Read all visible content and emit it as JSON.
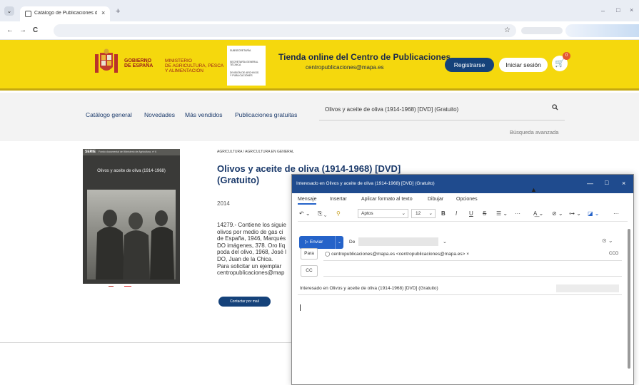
{
  "browser": {
    "tab_title": "Catálogo de Publicaciones del",
    "tab_close": "×",
    "new_tab": "+",
    "win_min": "–",
    "win_max": "□",
    "win_close": "×",
    "back": "←",
    "forward": "→",
    "reload": "C",
    "star": "☆",
    "menu": "⌄"
  },
  "header": {
    "gobierno": [
      "GOBIERNO",
      "DE ESPAÑA"
    ],
    "ministerio": [
      "MINISTERIO",
      "DE AGRICULTURA, PESCA",
      "Y ALIMENTACIÓN"
    ],
    "subsec": [
      "SUBSECRETARÍA",
      "",
      "SECRETARÍA GENERAL",
      "TÉCNICA",
      "",
      "DIVISIÓN DE ARCHIVOS",
      "Y PUBLICACIONES"
    ],
    "store_title": "Tienda online del Centro de Publicaciones",
    "store_email": "centropublicaciones@mapa.es",
    "register": "Registrarse",
    "login": "Iniciar sesión",
    "cart_count": "0"
  },
  "nav": {
    "links": [
      "Catálogo general",
      "Novedades",
      "Más vendidos",
      "Publicaciones gratuitas"
    ],
    "search_value": "Olivos y aceite de oliva (1914-1968) [DVD] (Gratuito)",
    "advanced": "Búsqueda avanzada"
  },
  "product": {
    "breadcrumb": "AGRICULTURA / AGRICULTURA EN GENERAL",
    "title": "Olivos y aceite de oliva (1914-1968) [DVD] (Gratuito)",
    "year": "2014",
    "description": [
      "14279.- Contiene los siguie",
      "olivos por medio de gas ci",
      "de España, 1946, Marqués",
      "DO imágenes, 378. Oro líq",
      "poda del olivo, 1968, José l",
      "DO, Juan de la Chica.",
      "Para solicitar un ejemplar",
      "centropublicaciones@map"
    ],
    "contact_button": "Contactar por mail",
    "cover_serie": "SERIE",
    "cover_serie_text": "Fondo documental del Ministerio de Agricultura, nº 6",
    "cover_title": "Olivos y aceite de oliva (1914-1968)"
  },
  "compose": {
    "window_title": "Interesado en Olivos y aceite de oliva (1914-1968) [DVD] (Gratuito)",
    "tabs": [
      "Mensaje",
      "Insertar",
      "Aplicar formato al texto",
      "Dibujar",
      "Opciones"
    ],
    "font": "Aptos",
    "font_size": "12",
    "send": "Enviar",
    "from_label": "De",
    "to_label": "Para",
    "to_value": "centropublicaciones@mapa.es <centropublicaciones@mapa.es>",
    "cco": "CCO",
    "cc_label": "CC",
    "subject": "Interesado en Olivos y aceite de oliva (1914-1968) [DVD] (Gratuito)",
    "min": "—",
    "max": "□",
    "close": "×"
  }
}
